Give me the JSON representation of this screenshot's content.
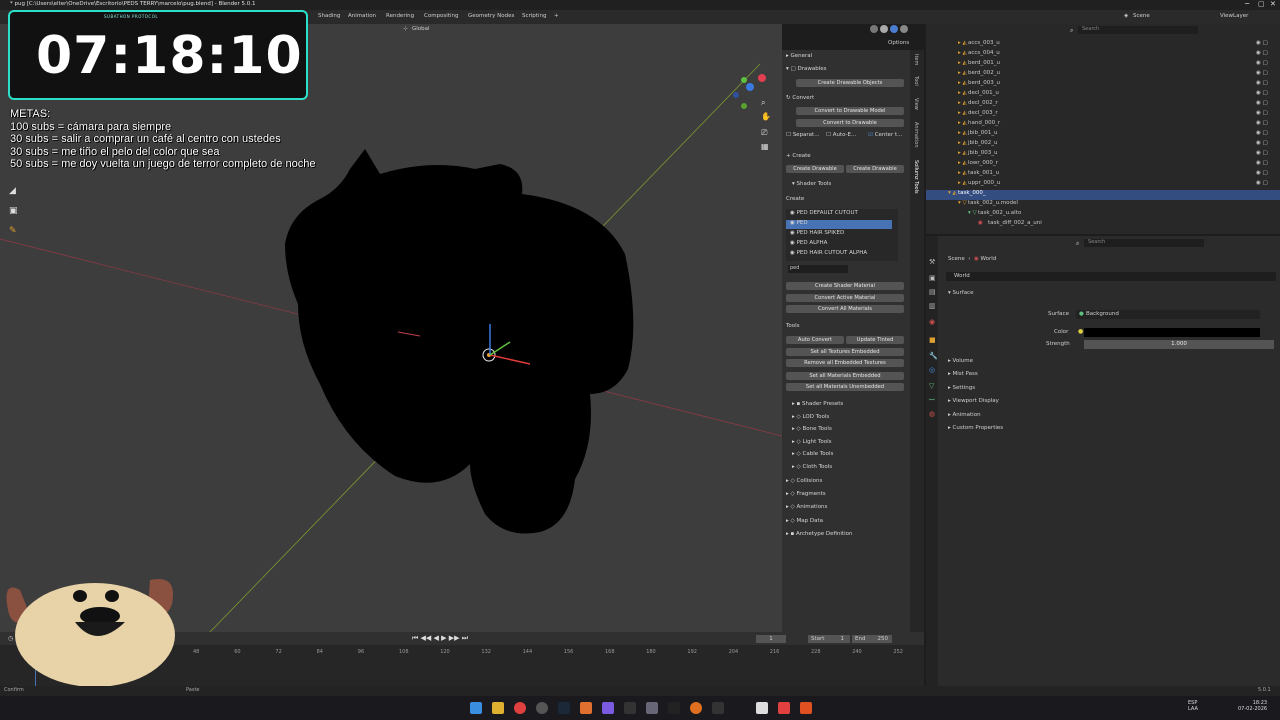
{
  "window": {
    "title": "* pug [C:\\Users\\elter\\OneDrive\\Escritorio\\PEDS TERRY\\marcelo\\pug.blend] - Blender 5.0.1"
  },
  "workspaces": [
    "Shading",
    "Animation",
    "Rendering",
    "Compositing",
    "Geometry Nodes",
    "Scripting",
    "+"
  ],
  "topright": {
    "scene": "Scene",
    "viewlayer": "ViewLayer"
  },
  "viewport": {
    "orientation": "Global",
    "options": "Options"
  },
  "stream": {
    "timer": "07:18:10",
    "timer_brand": "SUBATHON PROTOCOL",
    "goals_title": "METAS:",
    "goals": [
      "100 subs = cámara para siempre",
      "30 subs = salir a comprar un café al centro con ustedes",
      "30 subs = me tiño el pelo del color que sea",
      "50 subs = me doy vuelta un juego de terror completo de noche"
    ]
  },
  "npanel": {
    "general": "General",
    "drawables": "Drawables",
    "create_drawable_objects": "Create Drawable Objects",
    "convert": "Convert",
    "convert_to_drawable_model": "Convert to Drawable Model",
    "convert_to_drawable": "Convert to Drawable",
    "separate": "Separat...",
    "auto_e": "Auto-E...",
    "center": "Center t...",
    "create": "Create",
    "create_drawable_1": "Create Drawable",
    "create_drawable_2": "Create Drawable",
    "shader_tools": "Shader Tools",
    "create_label": "Create",
    "shaders": [
      "PED DEFAULT CUTOUT",
      "PED",
      "PED HAIR SPIKED",
      "PED ALPHA",
      "PED HAIR CUTOUT ALPHA"
    ],
    "shader_filter": "ped",
    "create_shader_material": "Create Shader Material",
    "convert_active_material": "Convert Active Material",
    "convert_all_materials": "Convert All Materials",
    "tools": "Tools",
    "auto_convert": "Auto Convert",
    "update_tinted": "Update Tinted",
    "set_all_textures_embedded": "Set all Textures Embedded",
    "remove_all_embedded": "Remove all Embedded Textures",
    "set_all_materials_embedded": "Set all Materials Embedded",
    "set_all_materials_unembedded": "Set all Materials Unembedded",
    "subpanels": [
      "Shader Presets",
      "LOD Tools",
      "Bone Tools",
      "Light Tools",
      "Cable Tools",
      "Cloth Tools"
    ],
    "sections": [
      "Collisions",
      "Fragments",
      "Animations",
      "Map Data",
      "Archetype Definition"
    ]
  },
  "ntabs": [
    "Item",
    "Tool",
    "View",
    "Animation",
    "Sollumz Tools"
  ],
  "outliner": {
    "search_placeholder": "Search",
    "rows": [
      "accs_003_u",
      "accs_004_u",
      "berd_001_u",
      "berd_002_u",
      "berd_003_u",
      "decl_001_u",
      "decl_002_r",
      "decl_003_r",
      "hand_000_r",
      "jbib_001_u",
      "jbib_002_u",
      "jbib_003_u",
      "lowr_000_r",
      "task_001_u",
      "uppr_000_u"
    ],
    "selected": "task_000_",
    "model": "task_002_u.model",
    "mat": "task_002_u.alto",
    "tex": "task_diff_002_a_uni"
  },
  "properties": {
    "search_placeholder": "Search",
    "breadcrumb_scene": "Scene",
    "breadcrumb_world": "World",
    "world_name": "World",
    "surface_header": "Surface",
    "surface_label": "Surface",
    "surface_value": "Background",
    "color_label": "Color",
    "strength_label": "Strength",
    "strength_value": "1.000",
    "sections": [
      "Volume",
      "Mist Pass",
      "Settings",
      "Viewport Display",
      "Animation",
      "Custom Properties"
    ]
  },
  "timeline": {
    "current_frame": "1",
    "start_label": "Start",
    "start": "1",
    "end_label": "End",
    "end": "250",
    "ticks": [
      "48",
      "60",
      "72",
      "84",
      "96",
      "108",
      "120",
      "132",
      "144",
      "156",
      "168",
      "180",
      "192",
      "204",
      "216",
      "228",
      "240",
      "252"
    ],
    "view_label": "Vi"
  },
  "statusbar": {
    "left": "Confirm",
    "mid": "Paste",
    "version": "5.0.1"
  },
  "taskbar": {
    "lang": "ESP",
    "lang2": "LAA",
    "time": "18:23",
    "date": "07-02-2026"
  }
}
